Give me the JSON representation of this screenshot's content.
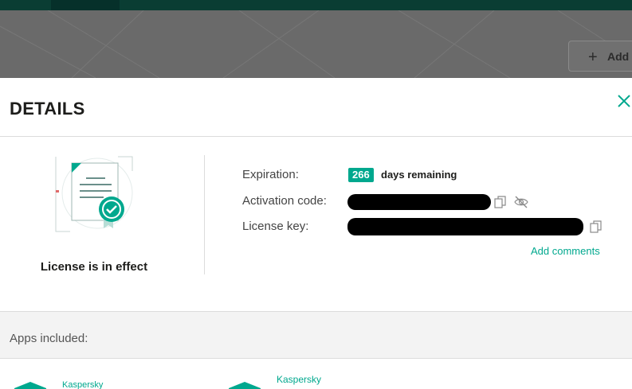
{
  "background": {
    "add_button_label": "Add"
  },
  "modal": {
    "title": "DETAILS",
    "status_label": "License is in effect",
    "expiration": {
      "label": "Expiration:",
      "days": "266",
      "days_suffix": "days remaining"
    },
    "activation_code": {
      "label": "Activation code:"
    },
    "license_key": {
      "label": "License key:"
    },
    "add_comments": "Add comments",
    "apps_included_title": "Apps included:",
    "apps": [
      {
        "name": "Kaspersky"
      },
      {
        "name": "Kaspersky"
      }
    ]
  },
  "colors": {
    "accent": "#00a88e",
    "topbar": "#0a3d33",
    "overlay": "#6a6a6a"
  },
  "icons": [
    "close-icon",
    "copy-icon",
    "eye-off-icon",
    "license-certificate-icon",
    "plus-icon",
    "kaspersky-logo-icon"
  ]
}
